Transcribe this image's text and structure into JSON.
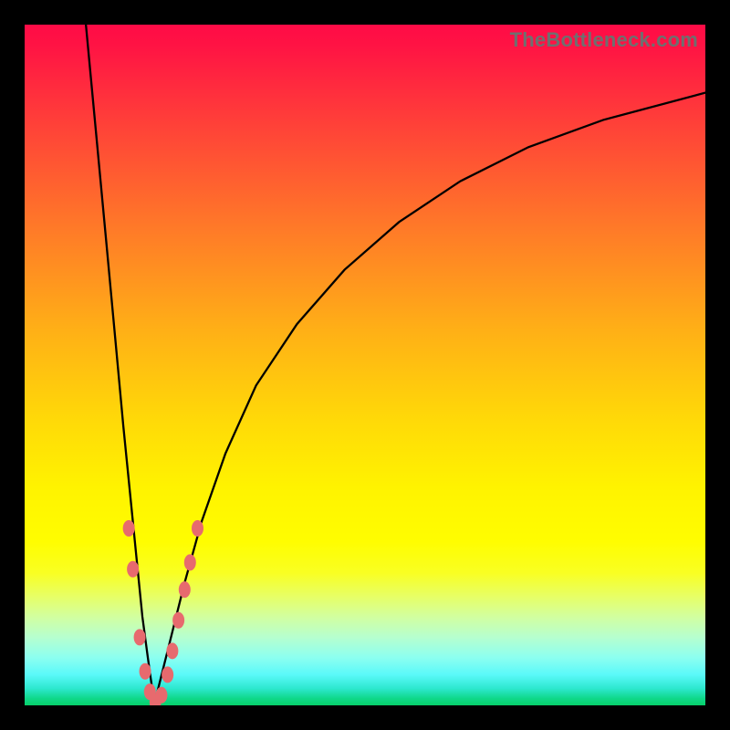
{
  "watermark": "TheBottleneck.com",
  "chart_data": {
    "type": "line",
    "title": "",
    "xlabel": "",
    "ylabel": "",
    "xlim": [
      0,
      100
    ],
    "ylim": [
      0,
      100
    ],
    "x_optimum_pct": 19,
    "series": [
      {
        "name": "left-branch",
        "x": [
          9.0,
          10.5,
          12.0,
          13.3,
          14.5,
          15.6,
          16.5,
          17.3,
          18.1,
          18.8,
          19.0
        ],
        "y": [
          100,
          84,
          68,
          54,
          41,
          30,
          21,
          13,
          7,
          2,
          0
        ]
      },
      {
        "name": "right-branch",
        "x": [
          19.0,
          20.0,
          21.5,
          23.5,
          26.0,
          29.5,
          34.0,
          40.0,
          47.0,
          55.0,
          64.0,
          74.0,
          85.0,
          100.0
        ],
        "y": [
          0,
          4,
          10,
          18,
          27,
          37,
          47,
          56,
          64,
          71,
          77,
          82,
          86,
          90
        ]
      }
    ],
    "markers": {
      "name": "highlight-dots",
      "color": "#e76a6e",
      "points": [
        {
          "x": 15.3,
          "y": 26.0
        },
        {
          "x": 15.9,
          "y": 20.0
        },
        {
          "x": 16.9,
          "y": 10.0
        },
        {
          "x": 17.7,
          "y": 5.0
        },
        {
          "x": 18.4,
          "y": 2.0
        },
        {
          "x": 19.2,
          "y": 0.5
        },
        {
          "x": 20.1,
          "y": 1.5
        },
        {
          "x": 21.0,
          "y": 4.5
        },
        {
          "x": 21.7,
          "y": 8.0
        },
        {
          "x": 22.6,
          "y": 12.5
        },
        {
          "x": 23.5,
          "y": 17.0
        },
        {
          "x": 24.3,
          "y": 21.0
        },
        {
          "x": 25.4,
          "y": 26.0
        }
      ]
    }
  }
}
